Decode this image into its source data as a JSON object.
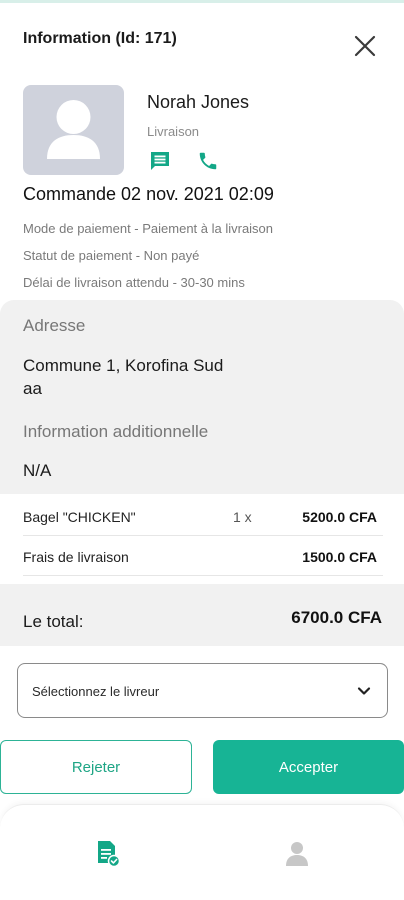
{
  "header": {
    "title": "Information (Id: 171)"
  },
  "customer": {
    "name": "Norah Jones",
    "role": "Livraison"
  },
  "order": {
    "title": "Commande 02 nov. 2021 02:09",
    "payment_mode": "Mode de paiement - Paiement à la livraison",
    "payment_status": "Statut de paiement - Non payé",
    "delivery_time": "Délai de livraison attendu - 30-30 mins"
  },
  "address": {
    "label": "Adresse",
    "line1": "Commune 1, Korofina Sud",
    "line2": "aa",
    "extra_label": "Information additionnelle",
    "extra_value": "N/A"
  },
  "items": [
    {
      "name": "Bagel \"CHICKEN\"",
      "qty": "1 x",
      "price": "5200.0 CFA"
    },
    {
      "name": "Frais de livraison",
      "qty": "",
      "price": "1500.0 CFA"
    }
  ],
  "total": {
    "label": "Le total:",
    "value": "6700.0 CFA"
  },
  "driver_select": {
    "value": "Sélectionnez le livreur"
  },
  "actions": {
    "reject": "Rejeter",
    "accept": "Accepter"
  },
  "colors": {
    "accent": "#17b495",
    "icon_green": "#13a787",
    "avatar_bg": "#cfd2dc",
    "panel_bg": "#f1f1f1"
  },
  "icons": {
    "close": "close-icon",
    "chat": "chat-icon",
    "phone": "phone-icon",
    "chevron": "chevron-down-icon",
    "orders_nav": "orders-icon",
    "profile_nav": "user-icon"
  }
}
